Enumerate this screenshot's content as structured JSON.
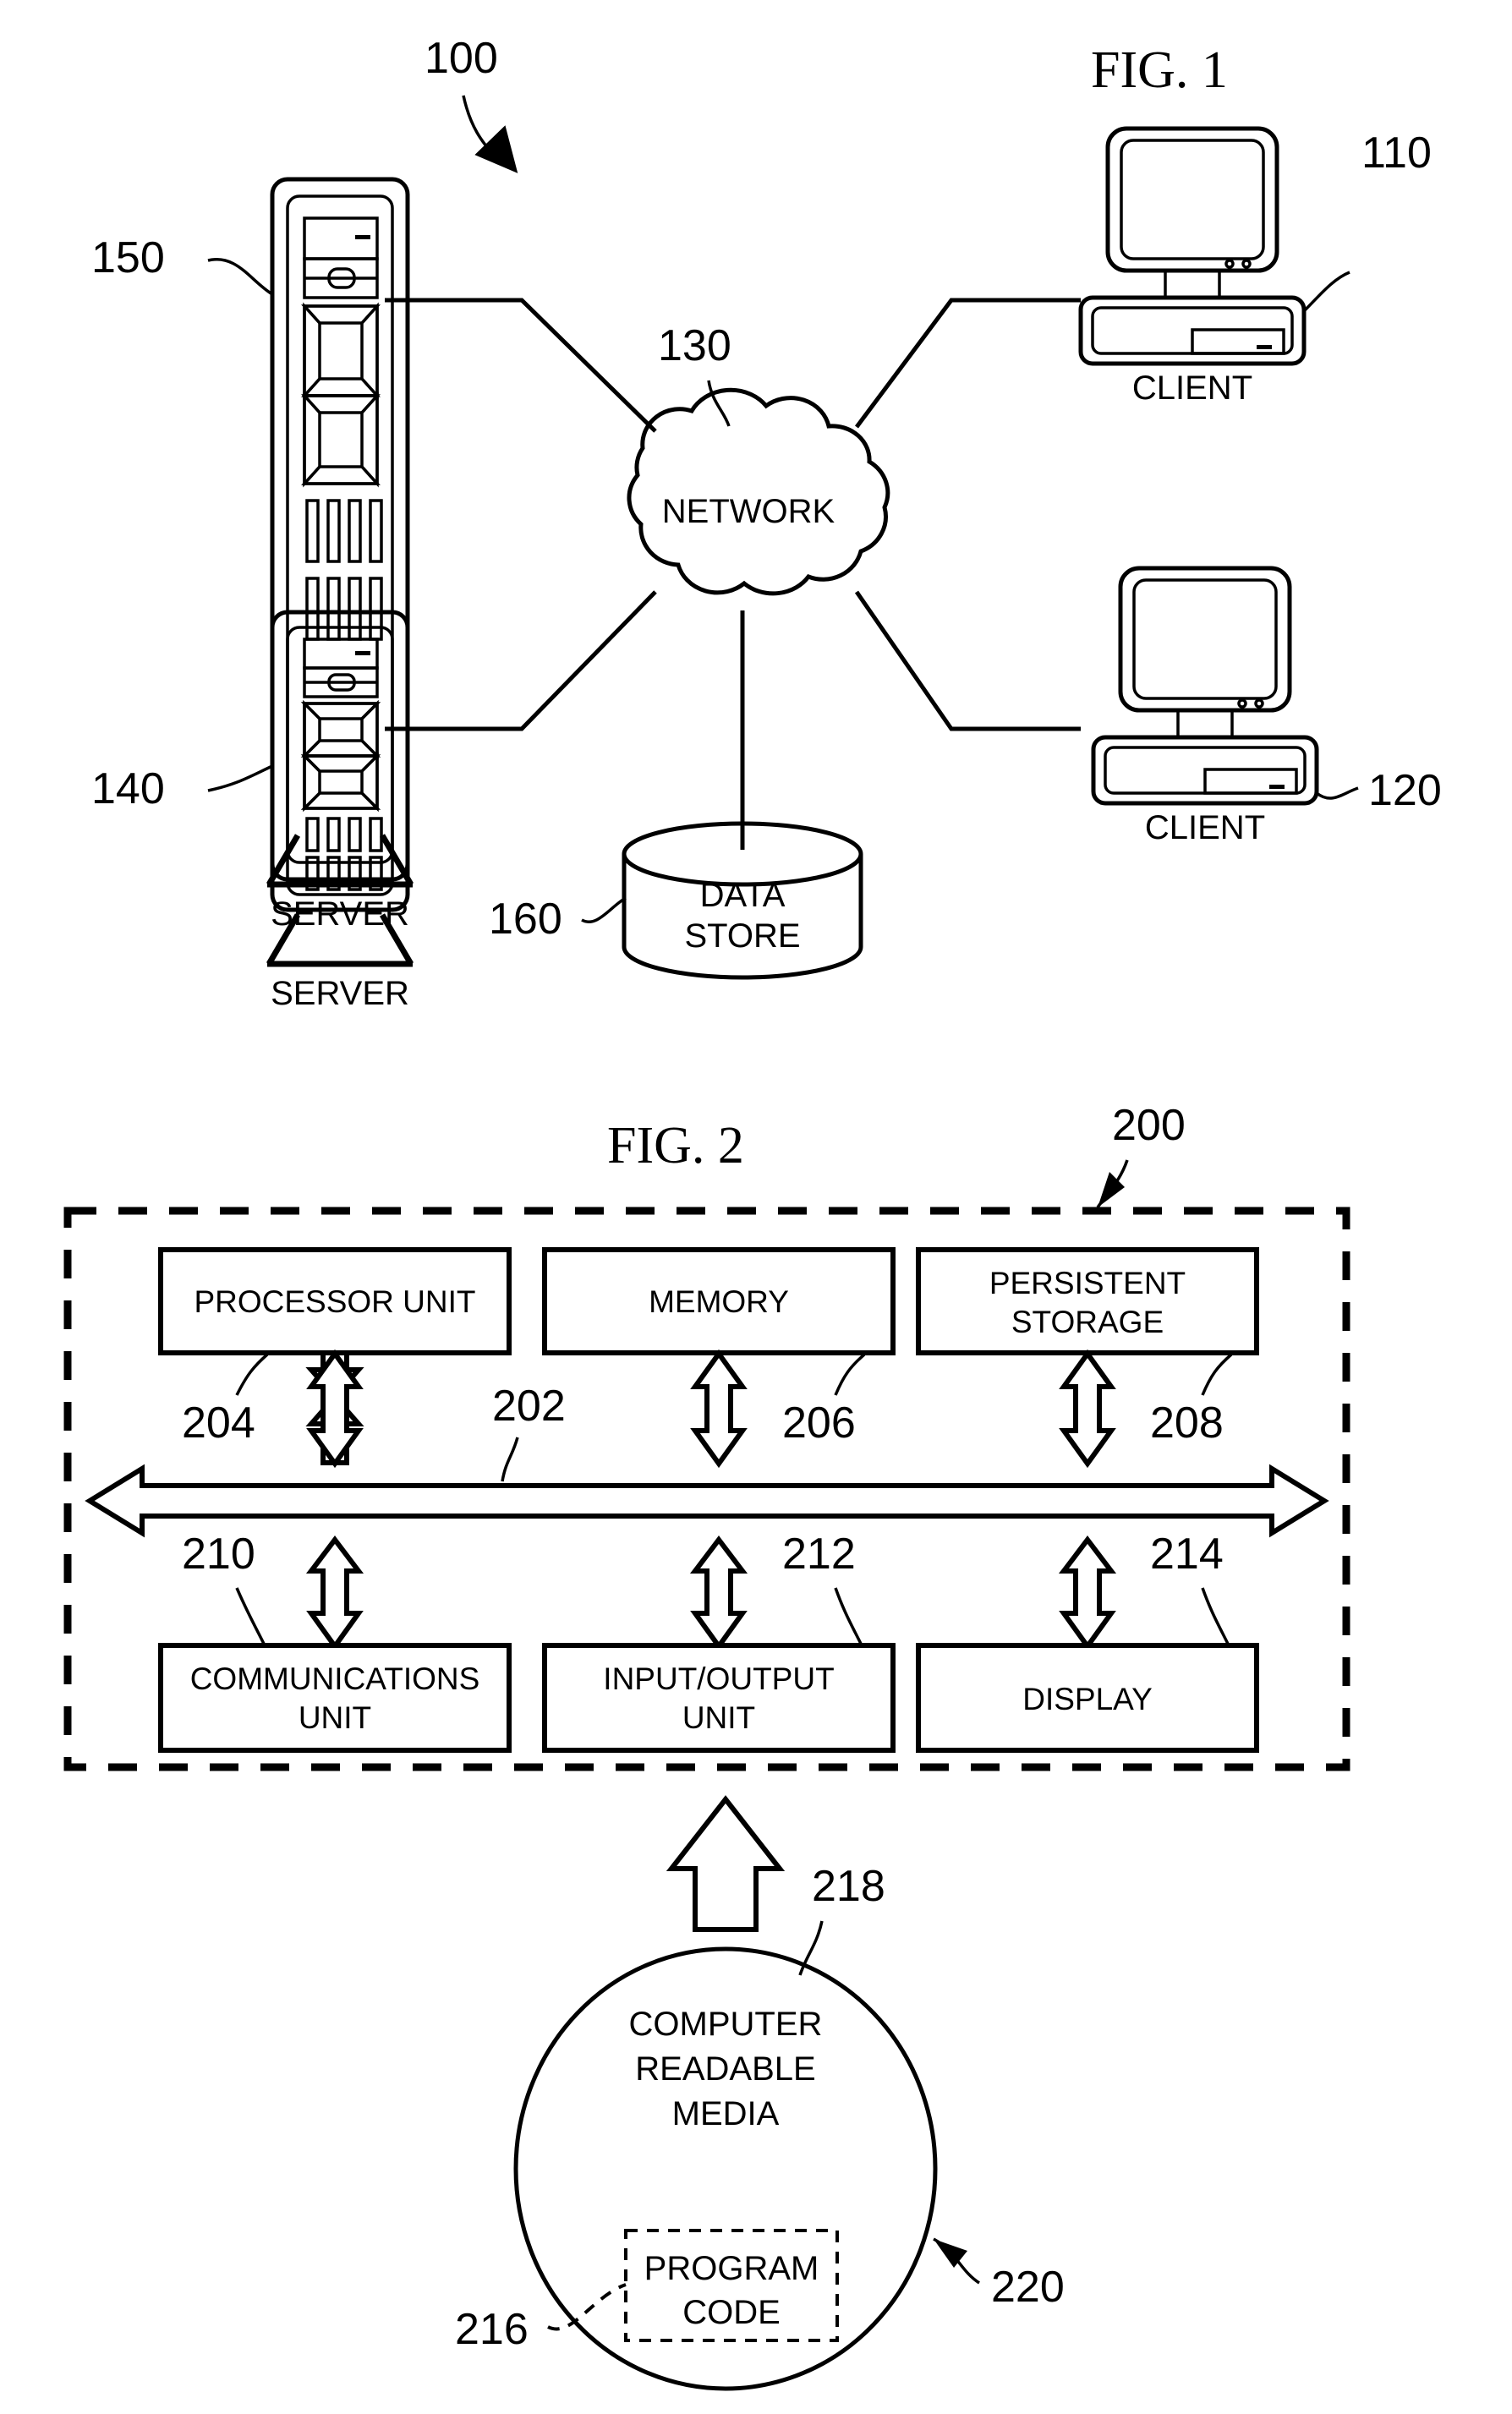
{
  "figure1": {
    "title": "FIG. 1",
    "system_ref": "100",
    "nodes": [
      {
        "id": "server-150",
        "label": "SERVER",
        "ref": "150",
        "type": "server-tower"
      },
      {
        "id": "server-140",
        "label": "SERVER",
        "ref": "140",
        "type": "server-tower"
      },
      {
        "id": "network-130",
        "label": "NETWORK",
        "ref": "130",
        "type": "cloud"
      },
      {
        "id": "client-110",
        "label": "CLIENT",
        "ref": "110",
        "type": "desktop-computer"
      },
      {
        "id": "client-120",
        "label": "CLIENT",
        "ref": "120",
        "type": "desktop-computer"
      },
      {
        "id": "datastore-160",
        "label_line1": "DATA",
        "label_line2": "STORE",
        "ref": "160",
        "type": "cylinder"
      }
    ]
  },
  "figure2": {
    "title": "FIG. 2",
    "system_ref": "200",
    "bus": {
      "ref": "202",
      "name": "communications-bus"
    },
    "top_row": [
      {
        "id": "processor-unit",
        "label_line1": "PROCESSOR UNIT",
        "label_line2": "",
        "ref": "204"
      },
      {
        "id": "memory",
        "label_line1": "MEMORY",
        "label_line2": "",
        "ref": "206"
      },
      {
        "id": "persistent-storage",
        "label_line1": "PERSISTENT",
        "label_line2": "STORAGE",
        "ref": "208"
      }
    ],
    "bottom_row": [
      {
        "id": "communications-unit",
        "label_line1": "COMMUNICATIONS",
        "label_line2": "UNIT",
        "ref": "210"
      },
      {
        "id": "input-output-unit",
        "label_line1": "INPUT/OUTPUT",
        "label_line2": "UNIT",
        "ref": "212"
      },
      {
        "id": "display",
        "label_line1": "DISPLAY",
        "label_line2": "",
        "ref": "214"
      }
    ],
    "media": {
      "label_line1": "COMPUTER",
      "label_line2": "READABLE",
      "label_line3": "MEDIA",
      "ref_circle": "220",
      "ref_arrow": "218",
      "program_code": {
        "label_line1": "PROGRAM",
        "label_line2": "CODE",
        "ref": "216"
      }
    }
  },
  "colors": {
    "ink": "#000000",
    "paper": "#ffffff"
  }
}
